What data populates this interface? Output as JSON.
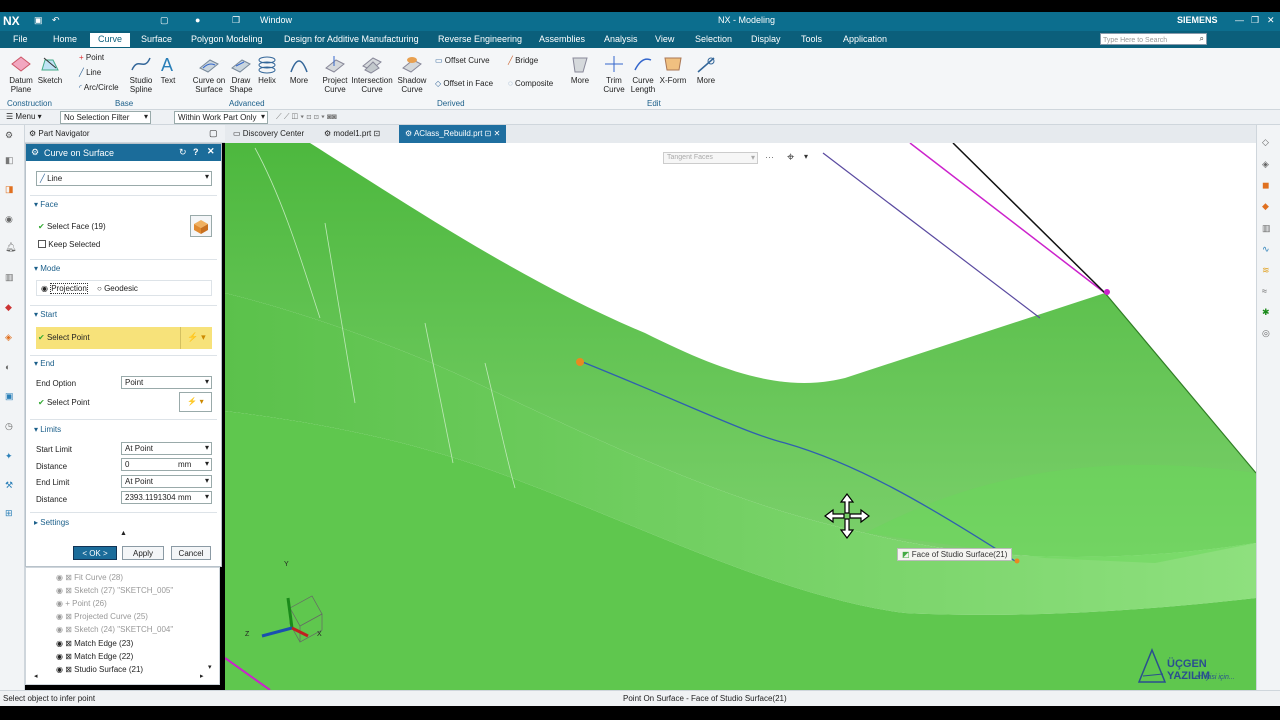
{
  "app": {
    "logo": "NX",
    "window_label": "Window",
    "title": "NX - Modeling",
    "brand": "SIEMENS",
    "search_placeholder": "Type Here to Search"
  },
  "menu": [
    "File",
    "Home",
    "Curve",
    "Surface",
    "Polygon Modeling",
    "Design for Additive Manufacturing",
    "Reverse Engineering",
    "Assemblies",
    "Analysis",
    "View",
    "Selection",
    "Display",
    "Tools",
    "Application"
  ],
  "ribbon": {
    "datum": "Datum Plane",
    "sketch": "Sketch",
    "point": "Point",
    "line": "Line",
    "arc": "Arc/Circle",
    "studio_spline": "Studio Spline",
    "text": "Text",
    "curve_on_surface": "Curve on Surface",
    "draw_shape": "Draw Shape",
    "helix": "Helix",
    "more": "More",
    "project_curve": "Project Curve",
    "intersection_curve": "Intersection Curve",
    "shadow_curve": "Shadow Curve",
    "offset_curve": "Offset Curve",
    "offset_in_face": "Offset in Face",
    "bridge": "Bridge",
    "composite": "Composite",
    "trim_curve": "Trim Curve",
    "curve_length": "Curve Length",
    "xform": "X-Form",
    "groups": {
      "construction": "Construction",
      "base": "Base",
      "advanced": "Advanced",
      "derived": "Derived",
      "edit": "Edit"
    }
  },
  "filterbar": {
    "menu": "Menu",
    "selection_filter": "No Selection Filter",
    "scope": "Within Work Part Only"
  },
  "tabs": [
    "Discovery Center",
    "model1.prt",
    "AClass_Rebuild.prt"
  ],
  "partnav": "Part Navigator",
  "dialog": {
    "title": "Curve on Surface",
    "type": "Line",
    "face_section": "Face",
    "select_face": "Select Face (19)",
    "keep_selected": "Keep Selected",
    "mode_section": "Mode",
    "projection": "Projection",
    "geodesic": "Geodesic",
    "start_section": "Start",
    "start_select": "Select Point",
    "end_section": "End",
    "end_option_label": "End Option",
    "end_option": "Point",
    "end_select": "Select Point",
    "limits_section": "Limits",
    "start_limit_label": "Start Limit",
    "start_limit": "At Point",
    "distance_label": "Distance",
    "distance1": "0",
    "unit": "mm",
    "end_limit_label": "End Limit",
    "end_limit": "At Point",
    "distance2": "2393.1191304",
    "settings": "Settings",
    "ok": "< OK >",
    "apply": "Apply",
    "cancel": "Cancel"
  },
  "tree": [
    "Fit Curve (28)",
    "Sketch (27) \"SKETCH_005\"",
    "Point (26)",
    "Projected Curve (25)",
    "Sketch (24) \"SKETCH_004\"",
    "Match Edge (23)",
    "Match Edge (22)",
    "Studio Surface (21)"
  ],
  "viewport": {
    "filter": "Tangent Faces",
    "tooltip": "Face of Studio Surface(21)",
    "watermark": "ÜÇGEN YAZILIM",
    "tagline": "en iyisi için...",
    "axis_x": "X",
    "axis_y": "Y",
    "axis_z": "Z"
  },
  "status": {
    "left": "Select object to infer point",
    "center": "Point On Surface - Face of Studio Surface(21)"
  },
  "colors": {
    "accent": "#0c6e8e",
    "surface": "#66cc55",
    "highlight": "#f7e27a"
  }
}
